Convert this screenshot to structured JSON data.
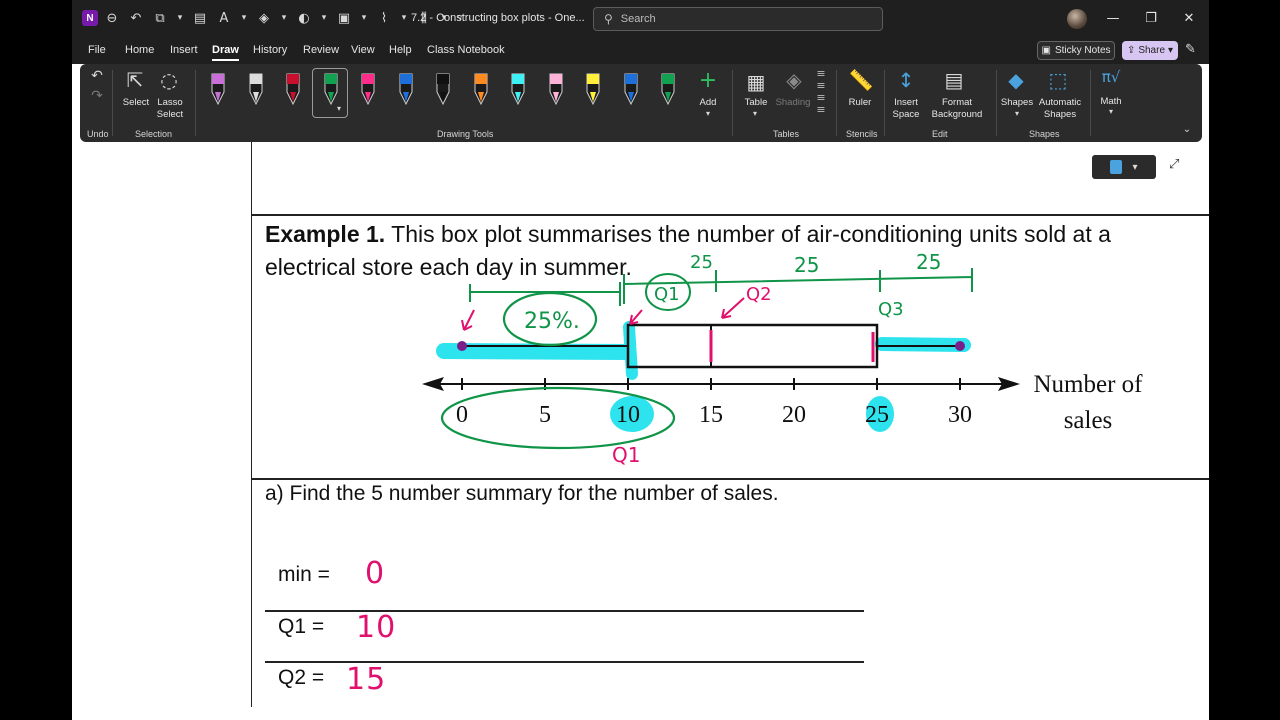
{
  "titlebar": {
    "doc_title": "7.2 - Constructing box plots  -  One...",
    "search_placeholder": "Search",
    "app_badge": "N"
  },
  "menu": [
    "File",
    "Home",
    "Insert",
    "Draw",
    "History",
    "Review",
    "View",
    "Help",
    "Class Notebook"
  ],
  "menu_active": "Draw",
  "menu_right": {
    "sticky_notes": "Sticky Notes",
    "share": "Share"
  },
  "ribbon": {
    "undo_label": "Undo",
    "select_label": "Select",
    "lasso_label": "Lasso\nSelect",
    "selection_group": "Selection",
    "add_label": "Add",
    "drawing_tools_group": "Drawing Tools",
    "table_label": "Table",
    "shading_label": "Shading",
    "tables_group": "Tables",
    "ruler_label": "Ruler",
    "stencils_group": "Stencils",
    "insert_space_label": "Insert\nSpace",
    "format_bg_label": "Format\nBackground",
    "edit_group": "Edit",
    "shapes_label": "Shapes",
    "auto_shapes_label": "Automatic\nShapes",
    "shapes_group": "Shapes",
    "math_label": "Math",
    "pens": [
      {
        "name": "eraser-pen",
        "color": "#c86fd8"
      },
      {
        "name": "text-pen",
        "color": "#dcdcdc"
      },
      {
        "name": "red-pen",
        "color": "#c8102e"
      },
      {
        "name": "green-pen",
        "color": "#12a150"
      },
      {
        "name": "pink-pen",
        "color": "#ff2d8a"
      },
      {
        "name": "blue-pen",
        "color": "#1e6fd9"
      },
      {
        "name": "black-pen",
        "color": "#111111"
      },
      {
        "name": "orange-highlighter",
        "color": "#ff8a1f"
      },
      {
        "name": "cyan-highlighter",
        "color": "#3ff0f5"
      },
      {
        "name": "pink-highlighter",
        "color": "#ffb3d9"
      },
      {
        "name": "yellow-highlighter",
        "color": "#ffef3a"
      },
      {
        "name": "blue-pencil",
        "color": "#1e6fd9"
      },
      {
        "name": "green-pencil",
        "color": "#12a150"
      }
    ]
  },
  "content": {
    "example_bold": "Example 1.",
    "example_line1": " This box plot summarises the number of air-conditioning units sold at a",
    "example_line2": "electrical store each day in summer.",
    "question_a": "a) Find the 5 number summary for the number of sales.",
    "summary": [
      {
        "label": "min =",
        "value": "0"
      },
      {
        "label": "Q1 =",
        "value": "10"
      },
      {
        "label": "Q2 =",
        "value": "15"
      }
    ]
  },
  "box_plot": {
    "ticks": [
      "0",
      "5",
      "10",
      "15",
      "20",
      "25",
      "30"
    ],
    "axis_title_line1": "Number of",
    "axis_title_line2": "sales",
    "min": 0,
    "q1": 10,
    "median": 15,
    "q3": 25,
    "max": 30
  },
  "annotations": {
    "percent": "25%.",
    "q1_top": "Q1",
    "q2": "Q2",
    "q3": "Q3",
    "q1_bottom": "Q1",
    "seg_a": "25",
    "seg_b": "25",
    "seg_c": "25"
  },
  "colors": {
    "ink_green": "#109448",
    "ink_pink": "#e0106d",
    "highlight_cyan": "#2de3ee"
  }
}
